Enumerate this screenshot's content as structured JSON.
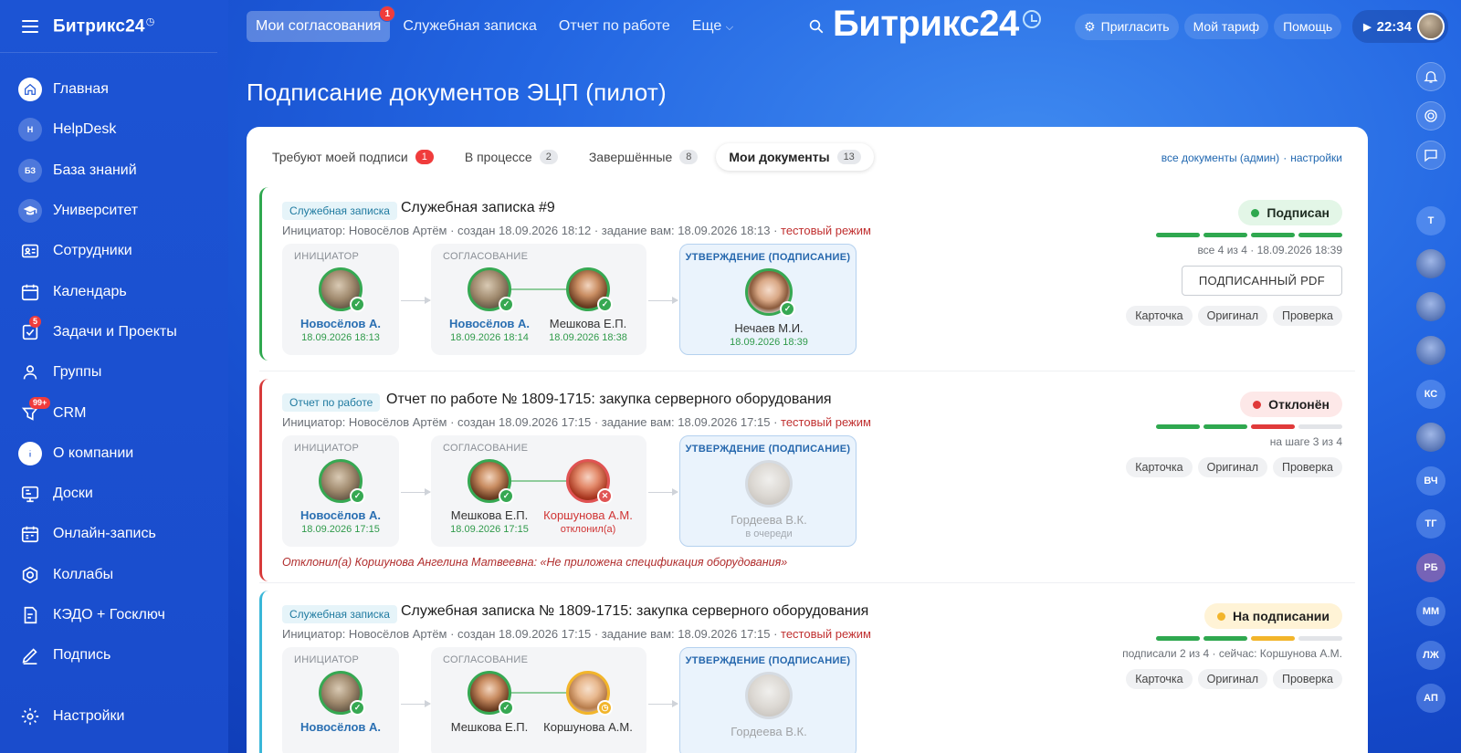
{
  "sidebar": {
    "logo": "Битрикс24",
    "items": [
      {
        "label": "Главная",
        "icon": "home-icon"
      },
      {
        "label": "HelpDesk",
        "icon": "helpdesk-icon",
        "initials": "H"
      },
      {
        "label": "База знаний",
        "icon": "knowledge-base-icon",
        "initials": "БЗ"
      },
      {
        "label": "Университет",
        "icon": "graduation-cap-icon"
      },
      {
        "label": "Сотрудники",
        "icon": "employees-icon"
      },
      {
        "label": "Календарь",
        "icon": "calendar-icon"
      },
      {
        "label": "Задачи и Проекты",
        "icon": "tasks-icon",
        "badge": "5"
      },
      {
        "label": "Группы",
        "icon": "groups-icon"
      },
      {
        "label": "CRM",
        "icon": "crm-icon",
        "badge": "99+"
      },
      {
        "label": "О компании",
        "icon": "company-icon"
      },
      {
        "label": "Доски",
        "icon": "boards-icon"
      },
      {
        "label": "Онлайн-запись",
        "icon": "booking-icon"
      },
      {
        "label": "Коллабы",
        "icon": "collabs-icon"
      },
      {
        "label": "КЭДО + Госключ",
        "icon": "kedo-icon"
      },
      {
        "label": "Подпись",
        "icon": "signature-icon"
      }
    ],
    "settings": "Настройки"
  },
  "topnav": {
    "tabs": [
      {
        "label": "Мои согласования",
        "badge": "1"
      },
      {
        "label": "Служебная записка"
      },
      {
        "label": "Отчет по работе"
      },
      {
        "label": "Еще"
      }
    ],
    "brand": "Битрикс24",
    "invite": "Пригласить",
    "tariff": "Мой тариф",
    "help": "Помощь",
    "time": "22:34"
  },
  "page_title": "Подписание документов ЭЦП (пилот)",
  "tabs": [
    {
      "label": "Требуют моей подписи",
      "count": "1"
    },
    {
      "label": "В процессе",
      "count": "2"
    },
    {
      "label": "Завершённые",
      "count": "8"
    },
    {
      "label": "Мои документы",
      "count": "13"
    }
  ],
  "admin_links": {
    "all": "все документы (админ)",
    "sep": "·",
    "settings": "настройки"
  },
  "stage_labels": {
    "initiator": "ИНИЦИАТОР",
    "approval": "СОГЛАСОВАНИЕ",
    "signing": "УТВЕРЖДЕНИЕ (ПОДПИСАНИЕ)"
  },
  "actions": {
    "card": "Карточка",
    "original": "Оригинал",
    "check": "Проверка",
    "pdf": "ПОДПИСАННЫЙ PDF"
  },
  "documents": [
    {
      "type": "Служебная записка",
      "title": "Служебная записка #9",
      "meta": "Инициатор: Новосёлов Артём · создан 18.09.2026 18:12 · задание вам: 18.09.2026 18:13 · ",
      "test_mode": "тестовый режим",
      "status": "Подписан",
      "steps": [
        "done",
        "done",
        "done",
        "done"
      ],
      "progress": "все 4 из 4 · 18.09.2026 18:39",
      "initiator": {
        "name": "Новосёлов А.",
        "date": "18.09.2026 18:13"
      },
      "approvers": [
        {
          "name": "Новосёлов А.",
          "date": "18.09.2026 18:14"
        },
        {
          "name": "Мешкова Е.П.",
          "date": "18.09.2026 18:38"
        }
      ],
      "signer": {
        "name": "Нечаев М.И.",
        "date": "18.09.2026 18:39"
      }
    },
    {
      "type": "Отчет по работе",
      "title": "Отчет по работе № 1809-1715: закупка серверного оборудования",
      "meta": "Инициатор: Новосёлов Артём · создан 18.09.2026 17:15 · задание вам: 18.09.2026 17:15 · ",
      "test_mode": "тестовый режим",
      "status": "Отклонён",
      "steps": [
        "done",
        "done",
        "rejected",
        "none"
      ],
      "progress": "на шаге 3 из 4",
      "initiator": {
        "name": "Новосёлов А.",
        "date": "18.09.2026 17:15"
      },
      "approvers": [
        {
          "name": "Мешкова Е.П.",
          "date": "18.09.2026 17:15"
        },
        {
          "name": "Коршунова А.М.",
          "date": "отклонил(а)"
        }
      ],
      "signer": {
        "name": "Гордеева В.К.",
        "date": "в очереди"
      },
      "reason": "Отклонил(а) Коршунова Ангелина Матвеевна: «Не приложена спецификация оборудования»"
    },
    {
      "type": "Служебная записка",
      "title": "Служебная записка № 1809-1715: закупка серверного оборудования",
      "meta": "Инициатор: Новосёлов Артём · создан 18.09.2026 17:15 · задание вам: 18.09.2026 17:15 · ",
      "test_mode": "тестовый режим",
      "status": "На подписании",
      "steps": [
        "done",
        "done",
        "current",
        "none"
      ],
      "progress": "подписали 2 из 4 · сейчас: Коршунова А.М.",
      "initiator": {
        "name": "Новосёлов А."
      },
      "approvers": [
        {
          "name": "Мешкова Е.П."
        },
        {
          "name": "Коршунова А.М."
        }
      ],
      "signer": {
        "name": "Гордеева В.К."
      }
    }
  ],
  "right_bar": {
    "initials": [
      "Т",
      "КС",
      "ВЧ",
      "ТГ",
      "РБ",
      "ММ",
      "ЛЖ",
      "АП"
    ]
  }
}
